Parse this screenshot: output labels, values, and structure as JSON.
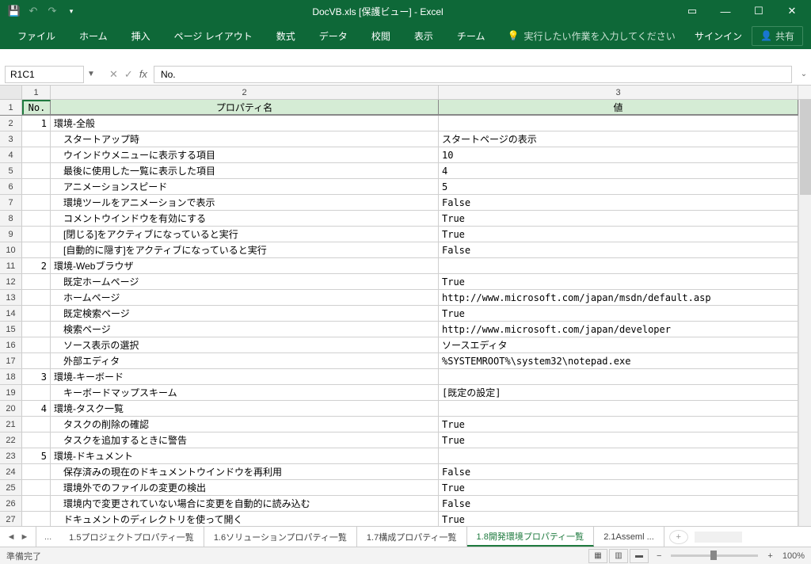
{
  "title": "DocVB.xls  [保護ビュー] - Excel",
  "ribbon": {
    "file": "ファイル",
    "home": "ホーム",
    "insert": "挿入",
    "layout": "ページ レイアウト",
    "formula": "数式",
    "data": "データ",
    "review": "校閲",
    "view": "表示",
    "team": "チーム",
    "tellme": "実行したい作業を入力してください",
    "signin": "サインイン",
    "share": "共有"
  },
  "namebox": "R1C1",
  "formula": "No.",
  "col_headers": [
    "1",
    "2",
    "3"
  ],
  "headers": {
    "no": "No.",
    "prop": "プロパティ名",
    "val": "値"
  },
  "rows": [
    {
      "r": "2",
      "no": "1",
      "p": "環境-全般",
      "v": ""
    },
    {
      "r": "3",
      "no": "",
      "p": "スタートアップ時",
      "v": "スタートページの表示"
    },
    {
      "r": "4",
      "no": "",
      "p": "ウインドウメニューに表示する項目",
      "v": "10"
    },
    {
      "r": "5",
      "no": "",
      "p": "最後に使用した一覧に表示した項目",
      "v": "4"
    },
    {
      "r": "6",
      "no": "",
      "p": "アニメーションスピード",
      "v": "5"
    },
    {
      "r": "7",
      "no": "",
      "p": "環境ツールをアニメーションで表示",
      "v": "False"
    },
    {
      "r": "8",
      "no": "",
      "p": "コメントウインドウを有効にする",
      "v": "True"
    },
    {
      "r": "9",
      "no": "",
      "p": "[閉じる]をアクティブになっていると実行",
      "v": "True"
    },
    {
      "r": "10",
      "no": "",
      "p": "[自動的に隠す]をアクティブになっていると実行",
      "v": "False"
    },
    {
      "r": "11",
      "no": "2",
      "p": "環境-Webブラウザ",
      "v": ""
    },
    {
      "r": "12",
      "no": "",
      "p": "既定ホームページ",
      "v": "True"
    },
    {
      "r": "13",
      "no": "",
      "p": "ホームページ",
      "v": "http://www.microsoft.com/japan/msdn/default.asp"
    },
    {
      "r": "14",
      "no": "",
      "p": "既定検索ページ",
      "v": "True"
    },
    {
      "r": "15",
      "no": "",
      "p": "検索ページ",
      "v": "http://www.microsoft.com/japan/developer"
    },
    {
      "r": "16",
      "no": "",
      "p": "ソース表示の選択",
      "v": "ソースエディタ"
    },
    {
      "r": "17",
      "no": "",
      "p": "外部エディタ",
      "v": "%SYSTEMROOT%\\system32\\notepad.exe"
    },
    {
      "r": "18",
      "no": "3",
      "p": "環境-キーボード",
      "v": ""
    },
    {
      "r": "19",
      "no": "",
      "p": "キーボードマップスキーム",
      "v": "[既定の設定]"
    },
    {
      "r": "20",
      "no": "4",
      "p": "環境-タスク一覧",
      "v": ""
    },
    {
      "r": "21",
      "no": "",
      "p": "タスクの削除の確認",
      "v": "True"
    },
    {
      "r": "22",
      "no": "",
      "p": "タスクを追加するときに警告",
      "v": "True"
    },
    {
      "r": "23",
      "no": "5",
      "p": "環境-ドキュメント",
      "v": ""
    },
    {
      "r": "24",
      "no": "",
      "p": "保存済みの現在のドキュメントウインドウを再利用",
      "v": "False"
    },
    {
      "r": "25",
      "no": "",
      "p": "環境外でのファイルの変更の検出",
      "v": "True"
    },
    {
      "r": "26",
      "no": "",
      "p": "環境内で変更されていない場合に変更を自動的に読み込む",
      "v": "False"
    },
    {
      "r": "27",
      "no": "",
      "p": "ドキュメントのディレクトリを使って開く",
      "v": "True"
    }
  ],
  "sheets": {
    "dots": "...",
    "s1": "1.5プロジェクトプロパティ一覧",
    "s2": "1.6ソリューションプロパティ一覧",
    "s3": "1.7構成プロパティ一覧",
    "s4": "1.8開発環境プロパティ一覧",
    "s5": "2.1Asseml ..."
  },
  "status": "準備完了",
  "zoom": "100%"
}
